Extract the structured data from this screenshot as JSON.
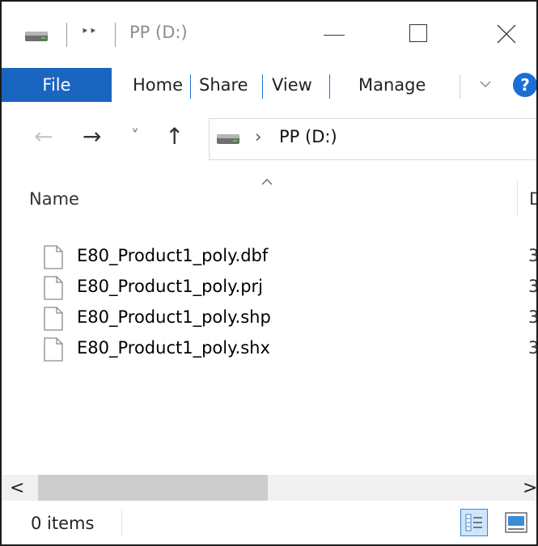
{
  "window": {
    "title": "PP (D:)",
    "quick_access_glyph": "‣‣"
  },
  "ribbon": {
    "tabs": [
      "File",
      "Home",
      "Share",
      "View",
      "Manage"
    ],
    "help_label": "?",
    "expand_icon": "chevron-down-icon"
  },
  "navigation": {
    "back_glyph": "←",
    "forward_glyph": "→",
    "recent_glyph": "˅",
    "up_glyph": "↑",
    "breadcrumb_separator": "›",
    "location": "PP (D:)"
  },
  "file_list": {
    "columns": [
      "Name",
      "D"
    ],
    "sort_indicator": "ascending",
    "files": [
      {
        "name": "E80_Product1_poly.dbf",
        "date_fragment": "3/"
      },
      {
        "name": "E80_Product1_poly.prj",
        "date_fragment": "3/"
      },
      {
        "name": "E80_Product1_poly.shp",
        "date_fragment": "3/"
      },
      {
        "name": "E80_Product1_poly.shx",
        "date_fragment": "3/"
      }
    ]
  },
  "scrollbar": {
    "left_glyph": "<",
    "right_glyph": ">"
  },
  "status": {
    "item_count": "0 items"
  },
  "colors": {
    "file_tab": "#1a65c0",
    "accent": "#1a6fd6",
    "scroll_thumb": "#cdcdcd"
  }
}
